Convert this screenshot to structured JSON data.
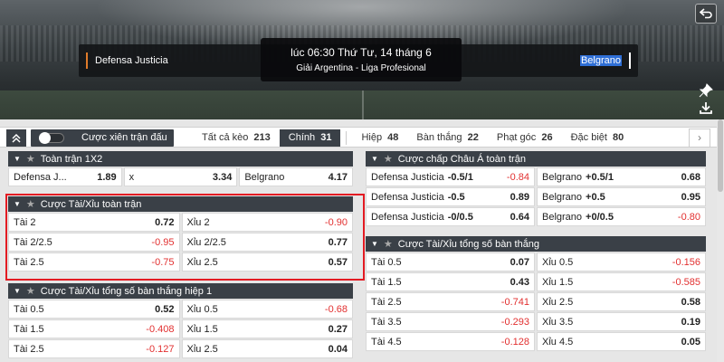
{
  "match": {
    "home_team": "Defensa Justicia",
    "away_team": "Belgrano",
    "time": "lúc 06:30 Thứ Tư, 14 tháng 6",
    "league": "Giải Argentina - Liga Profesional"
  },
  "filter": {
    "parlay_label": "Cược xiên trận đấu",
    "tabs": [
      {
        "label": "Tất cả kèo",
        "count": "213"
      },
      {
        "label": "Chính",
        "count": "31"
      },
      {
        "label": "Hiệp",
        "count": "48"
      },
      {
        "label": "Bàn thắng",
        "count": "22"
      },
      {
        "label": "Phạt góc",
        "count": "26"
      },
      {
        "label": "Đặc biệt",
        "count": "80"
      }
    ]
  },
  "panels": {
    "full_1x2": {
      "title": "Toàn trận 1X2",
      "cells": [
        {
          "label": "Defensa J...",
          "odd": "1.89"
        },
        {
          "label": "x",
          "odd": "3.34"
        },
        {
          "label": "Belgrano",
          "odd": "4.17"
        }
      ]
    },
    "over_under_full": {
      "title": "Cược Tài/Xỉu toàn trận",
      "rows": [
        [
          {
            "label": "Tài 2",
            "odd": "0.72"
          },
          {
            "label": "Xỉu 2",
            "odd": "-0.90"
          }
        ],
        [
          {
            "label": "Tài 2/2.5",
            "odd": "-0.95"
          },
          {
            "label": "Xỉu 2/2.5",
            "odd": "0.77"
          }
        ],
        [
          {
            "label": "Tài 2.5",
            "odd": "-0.75"
          },
          {
            "label": "Xỉu 2.5",
            "odd": "0.57"
          }
        ]
      ]
    },
    "over_under_half": {
      "title": "Cược Tài/Xỉu tổng số bàn thắng hiệp 1",
      "rows": [
        [
          {
            "label": "Tài 0.5",
            "odd": "0.52"
          },
          {
            "label": "Xỉu 0.5",
            "odd": "-0.68"
          }
        ],
        [
          {
            "label": "Tài 1.5",
            "odd": "-0.408"
          },
          {
            "label": "Xỉu 1.5",
            "odd": "0.27"
          }
        ],
        [
          {
            "label": "Tài 2.5",
            "odd": "-0.127"
          },
          {
            "label": "Xỉu 2.5",
            "odd": "0.04"
          }
        ]
      ]
    },
    "asian_handicap": {
      "title": "Cược chấp Châu Á toàn trận",
      "rows": [
        [
          {
            "label": "Defensa Justicia",
            "line": "-0.5/1",
            "odd": "-0.84"
          },
          {
            "label": "Belgrano",
            "line": "+0.5/1",
            "odd": "0.68"
          }
        ],
        [
          {
            "label": "Defensa Justicia",
            "line": "-0.5",
            "odd": "0.89"
          },
          {
            "label": "Belgrano",
            "line": "+0.5",
            "odd": "0.95"
          }
        ],
        [
          {
            "label": "Defensa Justicia",
            "line": "-0/0.5",
            "odd": "0.64"
          },
          {
            "label": "Belgrano",
            "line": "+0/0.5",
            "odd": "-0.80"
          }
        ]
      ]
    },
    "over_under_total": {
      "title": "Cược Tài/Xỉu tổng số bàn thắng",
      "rows": [
        [
          {
            "label": "Tài 0.5",
            "odd": "0.07"
          },
          {
            "label": "Xỉu 0.5",
            "odd": "-0.156"
          }
        ],
        [
          {
            "label": "Tài 1.5",
            "odd": "0.43"
          },
          {
            "label": "Xỉu 1.5",
            "odd": "-0.585"
          }
        ],
        [
          {
            "label": "Tài 2.5",
            "odd": "-0.741"
          },
          {
            "label": "Xỉu 2.5",
            "odd": "0.58"
          }
        ],
        [
          {
            "label": "Tài 3.5",
            "odd": "-0.293"
          },
          {
            "label": "Xỉu 3.5",
            "odd": "0.19"
          }
        ],
        [
          {
            "label": "Tài 4.5",
            "odd": "-0.128"
          },
          {
            "label": "Xỉu 4.5",
            "odd": "0.05"
          }
        ]
      ]
    }
  },
  "icons": {
    "back": "back-arrow-icon",
    "pin": "pin-icon",
    "download": "download-icon",
    "collapse": "double-chevron-up-icon",
    "next": "chevron-right-icon"
  },
  "colors": {
    "header_bg": "#3a4047",
    "negative_odd": "#e23030",
    "highlight_border": "#e31b23",
    "home_accent": "#e07b2a"
  }
}
